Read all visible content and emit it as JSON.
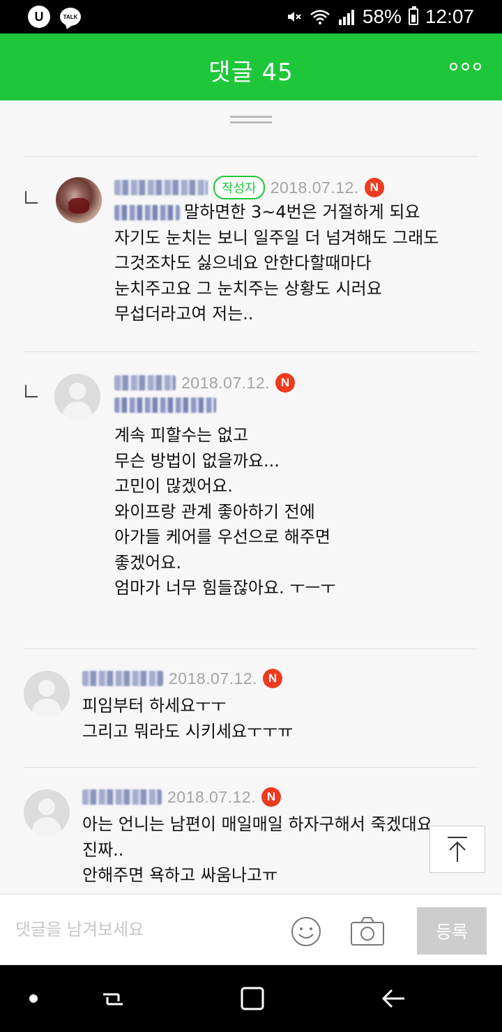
{
  "status_bar": {
    "battery": "58%",
    "time": "12:07",
    "app_icons": [
      "u-icon",
      "talk-icon"
    ],
    "talk_label": "TALK",
    "u_label": "U"
  },
  "header": {
    "title": "댓글 45"
  },
  "comments": [
    {
      "is_reply": true,
      "author_badge": "작성자",
      "date": "2018.07.12.",
      "new_label": "N",
      "lines": [
        "말하면한 3~4번은 거절하게 되요",
        "자기도 눈치는 보니 일주일 더 넘겨해도 그래도",
        "그것조차도 싫으네요 안한다할때마다",
        "눈치주고요 그 눈치주는 상황도 시러요",
        "무섭더라고여 저는.."
      ]
    },
    {
      "is_reply": true,
      "date": "2018.07.12.",
      "new_label": "N",
      "lines": [
        "계속 피할수는 없고",
        "무슨 방법이 없을까요...",
        "고민이 많겠어요.",
        "와이프랑 관계 좋아하기 전에",
        "아가들 케어를 우선으로 해주면",
        "좋겠어요.",
        "엄마가 너무 힘들잖아요. ㅜㅡㅜ"
      ]
    },
    {
      "is_reply": false,
      "date": "2018.07.12.",
      "new_label": "N",
      "lines": [
        "피임부터 하세요ㅜㅜ",
        "그리고 뭐라도 시키세요ㅜㅜㅠ"
      ]
    },
    {
      "is_reply": false,
      "date": "2018.07.12.",
      "new_label": "N",
      "lines": [
        "아는 언니는 남편이 매일매일 하자구해서 죽겠대요",
        "진짜..",
        "안해주면 욕하고 싸움나고ㅠ"
      ]
    }
  ],
  "input_bar": {
    "placeholder": "댓글을 남겨보세요",
    "submit_label": "등록"
  },
  "colors": {
    "brand_green": "#1ec73a",
    "new_badge": "#ee3a1f",
    "date_gray": "#a4a4a4"
  }
}
